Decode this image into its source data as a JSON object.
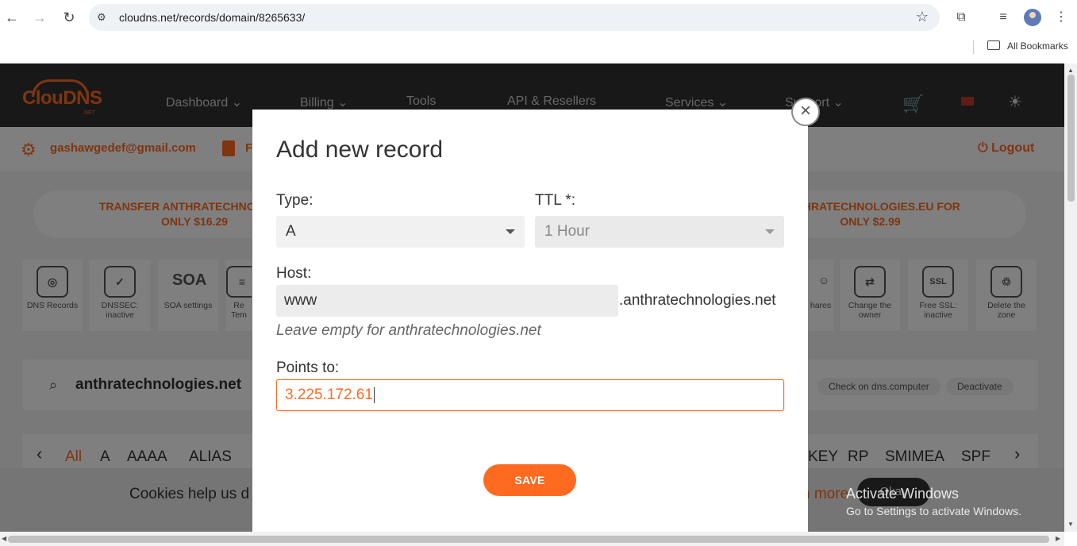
{
  "browser": {
    "url": "cloudns.net/records/domain/8265633/",
    "bookmarks_label": "All Bookmarks",
    "icons": {
      "back": "←",
      "forward": "→",
      "reload": "↻",
      "site_settings": "⚙",
      "bookmark": "☆",
      "extensions": "⧉",
      "media": "≡",
      "menu": "⋮"
    }
  },
  "site": {
    "logo": "ClouDNS",
    "logo_suffix": ".NET",
    "menu": [
      "Dashboard ⌄",
      "Billing ⌄",
      "Tools",
      "API & Resellers",
      "Services ⌄",
      "Support ⌄"
    ],
    "cart_icon": "🛒",
    "theme_icon": "☀",
    "user_email": "gashawgedef@gmail.com",
    "user_partial": "F",
    "logout": "Logout",
    "promo_left": [
      "TRANSFER ANTHRATECHNOLOGIE",
      "ONLY $16.29"
    ],
    "promo_right": [
      " ANTHRATECHNOLOGIES.EU FOR",
      "ONLY $2.99"
    ],
    "tools": [
      {
        "icon": "◎",
        "label": "DNS Records"
      },
      {
        "icon": "✓",
        "label": "DNSSEC: inactive"
      },
      {
        "icon": "SOA",
        "label": "SOA settings"
      },
      {
        "icon": "≡",
        "label": "Re Tem"
      },
      {
        "icon": "☺",
        "label": "hares"
      },
      {
        "icon": "⇄",
        "label": "Change the owner"
      },
      {
        "icon": "SSL",
        "label": "Free SSL: inactive"
      },
      {
        "icon": "♲",
        "label": "Delete the zone"
      }
    ],
    "domain": "anthratechnologies.net",
    "search_icon": "⌕",
    "check_btn": "Check on dns.computer",
    "deactivate_btn": "Deactivate",
    "record_types_left": [
      "All",
      "A",
      "AAAA",
      "ALIAS"
    ],
    "record_types_right": [
      "KEY",
      "RP",
      "SMIMEA",
      "SPF"
    ],
    "cookie_text": "Cookies help us d",
    "cookie_more": "n more",
    "cookie_ok": "Okay"
  },
  "modal": {
    "title": "Add new record",
    "close": "×",
    "type_label": "Type:",
    "type_value": "A",
    "ttl_label": "TTL *:",
    "ttl_value": "1 Hour",
    "host_label": "Host:",
    "host_value": "www",
    "host_suffix": ".anthratechnologies.net",
    "host_hint": "Leave empty for anthratechnologies.net",
    "points_label": "Points to:",
    "points_value": "3.225.172.61",
    "save": "SAVE"
  },
  "watermark": {
    "title": "Activate Windows",
    "subtitle": "Go to Settings to activate Windows."
  },
  "colors": {
    "accent": "#ff6a21",
    "header": "#303030"
  }
}
